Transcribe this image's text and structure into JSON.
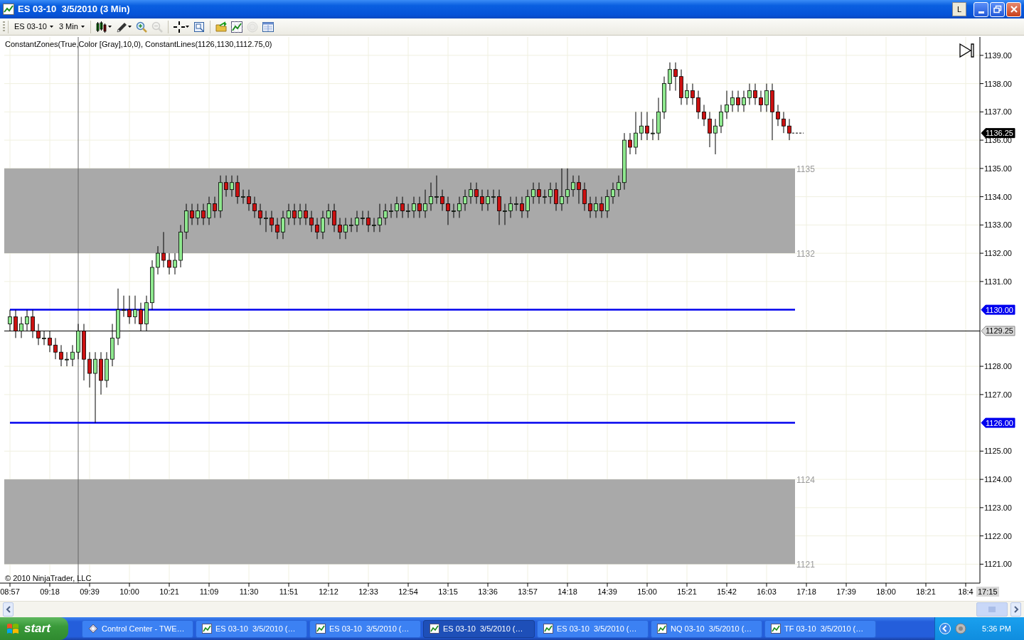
{
  "window": {
    "title": "ES 03-10  3/5/2010 (3 Min)",
    "link_button": "L"
  },
  "toolbar": {
    "instrument": "ES 03-10",
    "interval": "3 Min",
    "tools": [
      {
        "kind": "separator"
      },
      {
        "kind": "bars",
        "menu": true,
        "disabled": false
      },
      {
        "kind": "draw",
        "menu": true,
        "disabled": false
      },
      {
        "kind": "zoom-in",
        "menu": false,
        "disabled": false
      },
      {
        "kind": "zoom-out",
        "menu": false,
        "disabled": true
      },
      {
        "kind": "separator"
      },
      {
        "kind": "crosshair",
        "menu": true,
        "disabled": false
      },
      {
        "kind": "properties",
        "menu": false,
        "disabled": false
      },
      {
        "kind": "separator"
      },
      {
        "kind": "data-series",
        "menu": false,
        "disabled": false
      },
      {
        "kind": "chart",
        "menu": false,
        "disabled": false
      },
      {
        "kind": "strategy",
        "menu": false,
        "disabled": true
      },
      {
        "kind": "data-box",
        "menu": false,
        "disabled": false
      }
    ]
  },
  "chart": {
    "indicator_label": "ConstantZones(True,Color [Gray],10,0), ConstantLines(1126,1130,1112.75,0)",
    "copyright": "© 2010 NinjaTrader, LLC",
    "time_marker": "17:15",
    "zone_labels": [
      "1135",
      "1132",
      "1124",
      "1121"
    ],
    "last_price": "1136.25",
    "price_tags": [
      {
        "kind": "line",
        "label": "1130.00"
      },
      {
        "kind": "crosshair",
        "label": "1129.25"
      },
      {
        "kind": "line",
        "label": "1126.00"
      }
    ],
    "chart_data": {
      "type": "candlestick",
      "grid": true,
      "ylim": [
        1120.33,
        1139.65
      ],
      "categories": [
        "08:57",
        null,
        null,
        null,
        null,
        null,
        null,
        "09:18",
        null,
        null,
        null,
        null,
        null,
        null,
        "09:39",
        null,
        null,
        null,
        null,
        null,
        null,
        "10:00",
        null,
        null,
        null,
        null,
        null,
        null,
        "10:21",
        null,
        null,
        null,
        null,
        null,
        null,
        "11:09",
        null,
        null,
        null,
        null,
        null,
        null,
        "11:30",
        null,
        null,
        null,
        null,
        null,
        null,
        "11:51",
        null,
        null,
        null,
        null,
        null,
        null,
        "12:12",
        null,
        null,
        null,
        null,
        null,
        null,
        "12:33",
        null,
        null,
        null,
        null,
        null,
        null,
        "12:54",
        null,
        null,
        null,
        null,
        null,
        null,
        "13:15",
        null,
        null,
        null,
        null,
        null,
        null,
        "13:36",
        null,
        null,
        null,
        null,
        null,
        null,
        "13:57",
        null,
        null,
        null,
        null,
        null,
        null,
        "14:18",
        null,
        null,
        null,
        null,
        null,
        null,
        "14:39",
        null,
        null,
        null,
        null,
        null,
        null,
        "15:00",
        null,
        null,
        null,
        null,
        null,
        null,
        "15:21",
        null,
        null,
        null,
        null,
        null,
        null,
        "15:42",
        null,
        null,
        null,
        null,
        null,
        null,
        "16:03",
        null,
        null,
        null,
        null,
        null,
        null,
        "17:18",
        null,
        null,
        null,
        null,
        null,
        null,
        "17:39",
        null,
        null,
        null,
        null,
        null,
        null,
        "18:00",
        null,
        null,
        null,
        null,
        null,
        null,
        "18:21",
        null,
        null,
        null,
        null,
        null,
        null,
        "18:4"
      ],
      "yticks": [
        {
          "value": 1139,
          "label": "1139.00"
        },
        {
          "value": 1138,
          "label": "1138.00"
        },
        {
          "value": 1137,
          "label": "1137.00"
        },
        {
          "value": 1136,
          "label": "1136.00"
        },
        {
          "value": 1135,
          "label": "1135.00"
        },
        {
          "value": 1134,
          "label": "1134.00"
        },
        {
          "value": 1133,
          "label": "1133.00"
        },
        {
          "value": 1132,
          "label": "1132.00"
        },
        {
          "value": 1131,
          "label": "1131.00"
        },
        {
          "value": 1128,
          "label": "1128.00"
        },
        {
          "value": 1127,
          "label": "1127.00"
        },
        {
          "value": 1125,
          "label": "1125.00"
        },
        {
          "value": 1124,
          "label": "1124.00"
        },
        {
          "value": 1123,
          "label": "1123.00"
        },
        {
          "value": 1122,
          "label": "1122.00"
        },
        {
          "value": 1121,
          "label": "1121.00"
        }
      ],
      "ohlc": [
        [
          1129.5,
          1130,
          1129.25,
          1129.75
        ],
        [
          1129.75,
          1130,
          1129,
          1129.25
        ],
        [
          1129.25,
          1129.75,
          1129,
          1129.5
        ],
        [
          1129.5,
          1130,
          1129.25,
          1129.75
        ],
        [
          1129.75,
          1130,
          1129,
          1129.25
        ],
        [
          1129.25,
          1129.5,
          1128.75,
          1129
        ],
        [
          1129,
          1129.25,
          1128.75,
          1129
        ],
        [
          1129,
          1129.25,
          1128.5,
          1128.75
        ],
        [
          1128.75,
          1129,
          1128.25,
          1128.5
        ],
        [
          1128.5,
          1128.75,
          1128,
          1128.25
        ],
        [
          1128.25,
          1128.5,
          1128,
          1128.25
        ],
        [
          1128.25,
          1128.75,
          1128,
          1128.5
        ],
        [
          1128.5,
          1129.5,
          1128.25,
          1129.25
        ],
        [
          1129.25,
          1129.5,
          1127.5,
          1128.25
        ],
        [
          1128.25,
          1128.5,
          1127.25,
          1127.75
        ],
        [
          1127.75,
          1128.5,
          1126,
          1128.25
        ],
        [
          1128.25,
          1128.5,
          1127,
          1127.5
        ],
        [
          1127.5,
          1128.5,
          1127.25,
          1128.25
        ],
        [
          1128.25,
          1129.5,
          1128,
          1129
        ],
        [
          1129,
          1130.75,
          1128.75,
          1130
        ],
        [
          1130,
          1130.5,
          1129.75,
          1130
        ],
        [
          1130,
          1130.5,
          1129.5,
          1129.75
        ],
        [
          1129.75,
          1130.5,
          1129.5,
          1130
        ],
        [
          1130,
          1130.25,
          1129.25,
          1129.5
        ],
        [
          1129.5,
          1130.5,
          1129.25,
          1130.25
        ],
        [
          1130.25,
          1131.75,
          1130,
          1131.5
        ],
        [
          1131.5,
          1132.25,
          1131.25,
          1132
        ],
        [
          1132,
          1132.75,
          1131.5,
          1131.75
        ],
        [
          1131.75,
          1132,
          1131.25,
          1131.5
        ],
        [
          1131.5,
          1132,
          1131.25,
          1131.75
        ],
        [
          1131.75,
          1133,
          1131.5,
          1132.75
        ],
        [
          1132.75,
          1133.75,
          1132.5,
          1133.5
        ],
        [
          1133.5,
          1133.75,
          1133,
          1133.25
        ],
        [
          1133.25,
          1133.75,
          1133,
          1133.5
        ],
        [
          1133.5,
          1133.75,
          1133,
          1133.25
        ],
        [
          1133.25,
          1134,
          1133,
          1133.75
        ],
        [
          1133.75,
          1134,
          1133.25,
          1133.5
        ],
        [
          1133.5,
          1134.75,
          1133.25,
          1134.5
        ],
        [
          1134.5,
          1134.75,
          1134,
          1134.25
        ],
        [
          1134.25,
          1134.75,
          1134,
          1134.5
        ],
        [
          1134.5,
          1134.75,
          1133.75,
          1134
        ],
        [
          1134,
          1134.25,
          1133.75,
          1134
        ],
        [
          1134,
          1134.25,
          1133.5,
          1133.75
        ],
        [
          1133.75,
          1134,
          1133.25,
          1133.5
        ],
        [
          1133.5,
          1133.75,
          1133,
          1133.25
        ],
        [
          1133.25,
          1133.5,
          1132.75,
          1133.25
        ],
        [
          1133.25,
          1133.5,
          1132.75,
          1133
        ],
        [
          1133,
          1133.25,
          1132.5,
          1132.75
        ],
        [
          1132.75,
          1133.5,
          1132.5,
          1133.25
        ],
        [
          1133.25,
          1133.75,
          1133,
          1133.5
        ],
        [
          1133.5,
          1133.75,
          1133,
          1133.25
        ],
        [
          1133.25,
          1133.75,
          1133,
          1133.5
        ],
        [
          1133.5,
          1133.75,
          1133,
          1133.25
        ],
        [
          1133.25,
          1133.5,
          1132.75,
          1133
        ],
        [
          1133,
          1133.25,
          1132.5,
          1132.75
        ],
        [
          1132.75,
          1133.5,
          1132.5,
          1133.25
        ],
        [
          1133.25,
          1133.75,
          1133,
          1133.5
        ],
        [
          1133.5,
          1133.75,
          1132.75,
          1133
        ],
        [
          1133,
          1133.25,
          1132.5,
          1132.75
        ],
        [
          1132.75,
          1133.25,
          1132.5,
          1133
        ],
        [
          1133,
          1133.25,
          1132.75,
          1133
        ],
        [
          1133,
          1133.5,
          1132.75,
          1133.25
        ],
        [
          1133.25,
          1133.5,
          1133,
          1133.25
        ],
        [
          1133.25,
          1133.5,
          1132.75,
          1133
        ],
        [
          1133,
          1133.25,
          1132.75,
          1133
        ],
        [
          1133,
          1133.75,
          1132.75,
          1133.25
        ],
        [
          1133.25,
          1133.75,
          1133,
          1133.5
        ],
        [
          1133.5,
          1133.75,
          1133.25,
          1133.5
        ],
        [
          1133.5,
          1134,
          1133.25,
          1133.75
        ],
        [
          1133.75,
          1134,
          1133.25,
          1133.5
        ],
        [
          1133.5,
          1133.75,
          1133.25,
          1133.5
        ],
        [
          1133.5,
          1134,
          1133.25,
          1133.75
        ],
        [
          1133.75,
          1134,
          1133.25,
          1133.5
        ],
        [
          1133.5,
          1134.25,
          1133.25,
          1133.75
        ],
        [
          1133.75,
          1134.5,
          1133.5,
          1134
        ],
        [
          1134,
          1134.75,
          1133.75,
          1134
        ],
        [
          1134,
          1134.25,
          1133.5,
          1133.75
        ],
        [
          1133.75,
          1134,
          1133,
          1133.5
        ],
        [
          1133.5,
          1133.75,
          1133.25,
          1133.5
        ],
        [
          1133.5,
          1134,
          1133.25,
          1133.75
        ],
        [
          1133.75,
          1134.25,
          1133.5,
          1134
        ],
        [
          1134,
          1134.5,
          1133.75,
          1134.25
        ],
        [
          1134.25,
          1134.5,
          1133.75,
          1134
        ],
        [
          1134,
          1134.25,
          1133.5,
          1133.75
        ],
        [
          1133.75,
          1134.25,
          1133.5,
          1134
        ],
        [
          1134,
          1134.25,
          1133.75,
          1134
        ],
        [
          1134,
          1134.25,
          1133,
          1133.5
        ],
        [
          1133.5,
          1133.75,
          1133,
          1133.5
        ],
        [
          1133.5,
          1134,
          1133.25,
          1133.75
        ],
        [
          1133.75,
          1134,
          1133.5,
          1133.75
        ],
        [
          1133.75,
          1134,
          1133.25,
          1133.5
        ],
        [
          1133.5,
          1134.25,
          1133.25,
          1134
        ],
        [
          1134,
          1134.5,
          1133.75,
          1134.25
        ],
        [
          1134.25,
          1134.5,
          1133.75,
          1134
        ],
        [
          1134,
          1134.25,
          1133.75,
          1134
        ],
        [
          1134,
          1134.5,
          1133.75,
          1134.25
        ],
        [
          1134.25,
          1134.5,
          1133.5,
          1133.75
        ],
        [
          1133.75,
          1135,
          1133.5,
          1134
        ],
        [
          1134,
          1135,
          1133.75,
          1134.25
        ],
        [
          1134.25,
          1134.75,
          1134,
          1134.5
        ],
        [
          1134.5,
          1134.75,
          1133.75,
          1134.25
        ],
        [
          1134.25,
          1134.5,
          1133.5,
          1133.75
        ],
        [
          1133.75,
          1134,
          1133.25,
          1133.5
        ],
        [
          1133.5,
          1134,
          1133.25,
          1133.75
        ],
        [
          1133.75,
          1134,
          1133.25,
          1133.5
        ],
        [
          1133.5,
          1134.25,
          1133.25,
          1134
        ],
        [
          1134,
          1134.5,
          1133.75,
          1134.25
        ],
        [
          1134.25,
          1134.75,
          1134,
          1134.5
        ],
        [
          1134.5,
          1136.25,
          1134.25,
          1136
        ],
        [
          1136,
          1136.25,
          1135.5,
          1135.75
        ],
        [
          1135.75,
          1137,
          1135.5,
          1136.25
        ],
        [
          1136.25,
          1137,
          1136,
          1136.5
        ],
        [
          1136.5,
          1137,
          1136,
          1136.25
        ],
        [
          1136.25,
          1136.75,
          1136,
          1136.25
        ],
        [
          1136.25,
          1137.5,
          1136,
          1137
        ],
        [
          1137,
          1138.25,
          1136.75,
          1138
        ],
        [
          1138,
          1138.75,
          1137.75,
          1138.5
        ],
        [
          1138.5,
          1138.75,
          1137.75,
          1138.25
        ],
        [
          1138.25,
          1138.5,
          1137.25,
          1137.5
        ],
        [
          1137.5,
          1138,
          1137.25,
          1137.75
        ],
        [
          1137.75,
          1138,
          1137.25,
          1137.5
        ],
        [
          1137.5,
          1137.75,
          1136.75,
          1137
        ],
        [
          1137,
          1137.25,
          1136.5,
          1136.75
        ],
        [
          1136.75,
          1137,
          1135.75,
          1136.25
        ],
        [
          1136.25,
          1136.75,
          1135.5,
          1136.5
        ],
        [
          1136.5,
          1137.25,
          1136.25,
          1137
        ],
        [
          1137,
          1137.75,
          1136.75,
          1137.25
        ],
        [
          1137.25,
          1137.75,
          1137,
          1137.5
        ],
        [
          1137.5,
          1137.75,
          1137,
          1137.25
        ],
        [
          1137.25,
          1137.75,
          1137,
          1137.5
        ],
        [
          1137.5,
          1138,
          1137.25,
          1137.75
        ],
        [
          1137.75,
          1138,
          1137.25,
          1137.5
        ],
        [
          1137.5,
          1137.75,
          1137,
          1137.25
        ],
        [
          1137.25,
          1138,
          1137,
          1137.75
        ],
        [
          1137.75,
          1138,
          1136,
          1137
        ],
        [
          1137,
          1137.25,
          1136.5,
          1136.75
        ],
        [
          1136.75,
          1137,
          1136.25,
          1136.5
        ],
        [
          1136.5,
          1136.75,
          1136,
          1136.25
        ],
        null,
        null,
        null,
        null,
        null,
        null,
        null,
        null,
        null,
        null,
        null,
        null,
        null,
        null,
        null,
        null,
        null,
        null,
        null,
        null,
        null,
        null,
        null,
        null,
        null,
        null,
        null,
        null,
        null,
        null,
        null
      ],
      "bands": [
        {
          "axis": "y",
          "from": 1132,
          "to": 1135
        },
        {
          "axis": "y",
          "from": 1121,
          "to": 1124
        }
      ],
      "ref_lines": [
        {
          "axis": "y",
          "value": 1130
        },
        {
          "axis": "y",
          "value": 1129.25
        },
        {
          "axis": "y",
          "value": 1126
        }
      ]
    }
  },
  "taskbar": {
    "start": "start",
    "tasks": [
      {
        "kind": "control-center",
        "label": "Control Center - TWE…",
        "selected": false
      },
      {
        "kind": "chart",
        "label": "ES 03-10  3/5/2010 (…",
        "selected": false
      },
      {
        "kind": "chart",
        "label": "ES 03-10  3/5/2010 (…",
        "selected": false
      },
      {
        "kind": "chart",
        "label": "ES 03-10  3/5/2010 (…",
        "selected": true
      },
      {
        "kind": "chart",
        "label": "ES 03-10  3/5/2010 (…",
        "selected": false
      },
      {
        "kind": "chart",
        "label": "NQ 03-10  3/5/2010 (…",
        "selected": false
      },
      {
        "kind": "chart",
        "label": "TF 03-10  3/5/2010 (…",
        "selected": false
      }
    ],
    "clock": "5:36 PM"
  }
}
